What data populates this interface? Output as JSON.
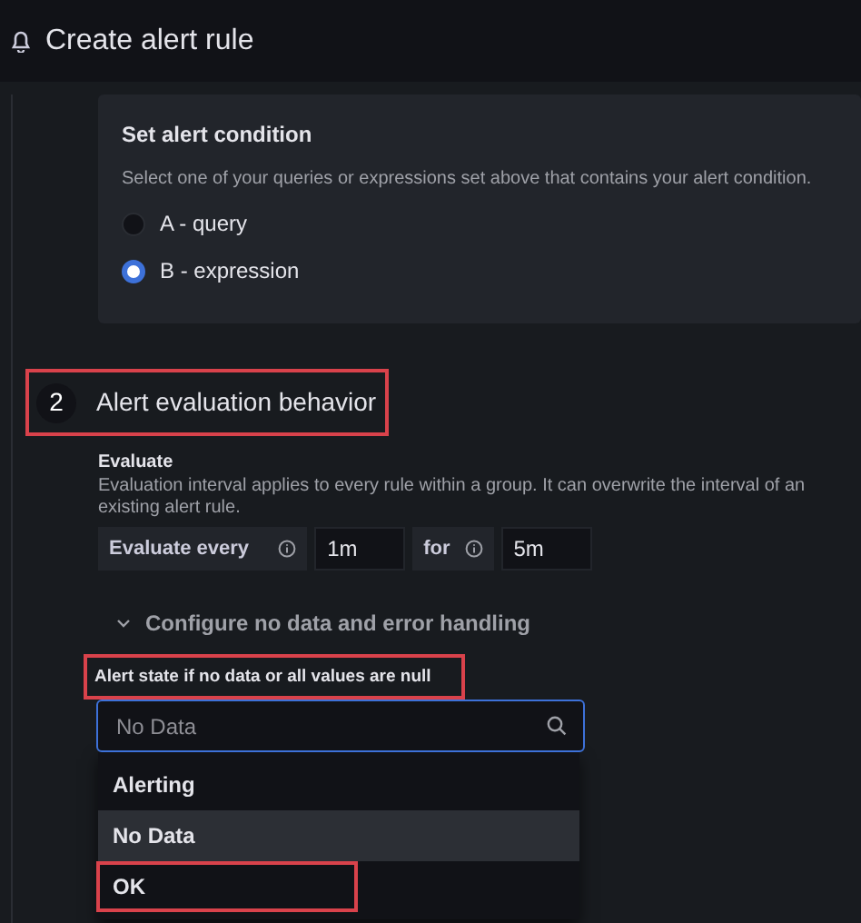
{
  "header": {
    "title": "Create alert rule"
  },
  "condition": {
    "title": "Set alert condition",
    "description": "Select one of your queries or expressions set above that contains your alert condition.",
    "options": [
      {
        "label": "A - query",
        "selected": false
      },
      {
        "label": "B - expression",
        "selected": true
      }
    ]
  },
  "section": {
    "number": "2",
    "title": "Alert evaluation behavior",
    "highlighted": true
  },
  "evaluate": {
    "label": "Evaluate",
    "description": "Evaluation interval applies to every rule within a group. It can overwrite the interval of an existing alert rule.",
    "every_label": "Evaluate every",
    "every_value": "1m",
    "for_label": "for",
    "for_value": "5m"
  },
  "no_data_toggle": {
    "label": "Configure no data and error handling",
    "expanded": true
  },
  "no_data_field": {
    "label": "Alert state if no data or all values are null",
    "label_highlighted": true,
    "placeholder": "No Data",
    "options": [
      {
        "label": "Alerting",
        "selected": false,
        "highlighted": false
      },
      {
        "label": "No Data",
        "selected": true,
        "highlighted": false
      },
      {
        "label": "OK",
        "selected": false,
        "highlighted": true
      }
    ]
  }
}
